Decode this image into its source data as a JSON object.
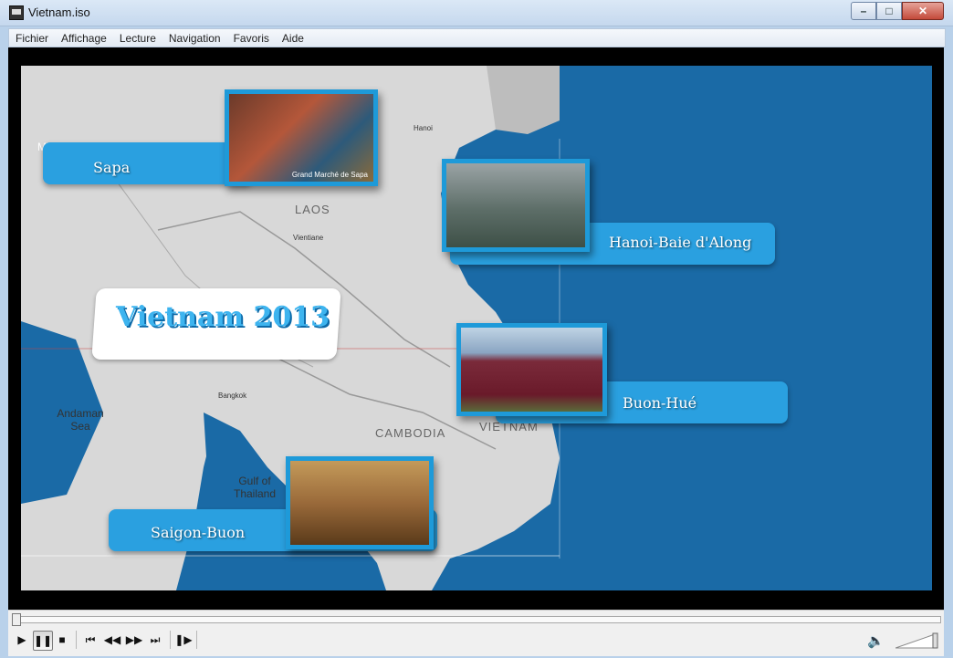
{
  "window": {
    "title": "Vietnam.iso",
    "min": "–",
    "max": "□",
    "close": "✕"
  },
  "menu": [
    "Fichier",
    "Affichage",
    "Lecture",
    "Navigation",
    "Favoris",
    "Aide"
  ],
  "headline": "Vietnam 2013",
  "places": {
    "sapa": "Sapa",
    "hanoi": "Hanoi-Baie d'Along",
    "hue": "Buon-Hué",
    "saigon": "Saigon-Buon"
  },
  "photo_captions": {
    "sapa": "Grand Marché de Sapa"
  },
  "map_labels": {
    "laos": "LAOS",
    "cambodia": "CAMBODIA",
    "vietnam": "VIETNAM",
    "andaman": "Andaman Sea",
    "gulf": "Gulf of Thailand",
    "my": "MY",
    "hanoi_city": "Hanoi",
    "bangkok": "Bangkok",
    "vientiane": "Vientiane"
  },
  "controls": {
    "play": "▶",
    "pause": "❚❚",
    "stop": "■",
    "prev": "⏮",
    "rewind": "◀◀",
    "forward": "▶▶",
    "next": "⏭",
    "step": "❚▶",
    "volume": "🔈"
  },
  "colors": {
    "ocean": "#1a6aa6",
    "accent": "#2aa0e0",
    "land": "#d6d6d6"
  }
}
